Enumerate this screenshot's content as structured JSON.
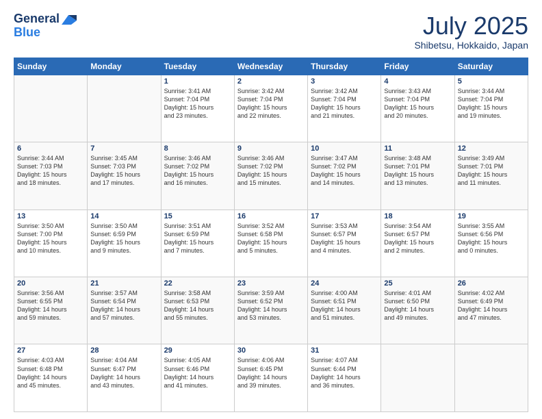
{
  "header": {
    "logo_line1": "General",
    "logo_line2": "Blue",
    "month": "July 2025",
    "location": "Shibetsu, Hokkaido, Japan"
  },
  "weekdays": [
    "Sunday",
    "Monday",
    "Tuesday",
    "Wednesday",
    "Thursday",
    "Friday",
    "Saturday"
  ],
  "weeks": [
    [
      {
        "day": "",
        "info": ""
      },
      {
        "day": "",
        "info": ""
      },
      {
        "day": "1",
        "info": "Sunrise: 3:41 AM\nSunset: 7:04 PM\nDaylight: 15 hours\nand 23 minutes."
      },
      {
        "day": "2",
        "info": "Sunrise: 3:42 AM\nSunset: 7:04 PM\nDaylight: 15 hours\nand 22 minutes."
      },
      {
        "day": "3",
        "info": "Sunrise: 3:42 AM\nSunset: 7:04 PM\nDaylight: 15 hours\nand 21 minutes."
      },
      {
        "day": "4",
        "info": "Sunrise: 3:43 AM\nSunset: 7:04 PM\nDaylight: 15 hours\nand 20 minutes."
      },
      {
        "day": "5",
        "info": "Sunrise: 3:44 AM\nSunset: 7:04 PM\nDaylight: 15 hours\nand 19 minutes."
      }
    ],
    [
      {
        "day": "6",
        "info": "Sunrise: 3:44 AM\nSunset: 7:03 PM\nDaylight: 15 hours\nand 18 minutes."
      },
      {
        "day": "7",
        "info": "Sunrise: 3:45 AM\nSunset: 7:03 PM\nDaylight: 15 hours\nand 17 minutes."
      },
      {
        "day": "8",
        "info": "Sunrise: 3:46 AM\nSunset: 7:02 PM\nDaylight: 15 hours\nand 16 minutes."
      },
      {
        "day": "9",
        "info": "Sunrise: 3:46 AM\nSunset: 7:02 PM\nDaylight: 15 hours\nand 15 minutes."
      },
      {
        "day": "10",
        "info": "Sunrise: 3:47 AM\nSunset: 7:02 PM\nDaylight: 15 hours\nand 14 minutes."
      },
      {
        "day": "11",
        "info": "Sunrise: 3:48 AM\nSunset: 7:01 PM\nDaylight: 15 hours\nand 13 minutes."
      },
      {
        "day": "12",
        "info": "Sunrise: 3:49 AM\nSunset: 7:01 PM\nDaylight: 15 hours\nand 11 minutes."
      }
    ],
    [
      {
        "day": "13",
        "info": "Sunrise: 3:50 AM\nSunset: 7:00 PM\nDaylight: 15 hours\nand 10 minutes."
      },
      {
        "day": "14",
        "info": "Sunrise: 3:50 AM\nSunset: 6:59 PM\nDaylight: 15 hours\nand 9 minutes."
      },
      {
        "day": "15",
        "info": "Sunrise: 3:51 AM\nSunset: 6:59 PM\nDaylight: 15 hours\nand 7 minutes."
      },
      {
        "day": "16",
        "info": "Sunrise: 3:52 AM\nSunset: 6:58 PM\nDaylight: 15 hours\nand 5 minutes."
      },
      {
        "day": "17",
        "info": "Sunrise: 3:53 AM\nSunset: 6:57 PM\nDaylight: 15 hours\nand 4 minutes."
      },
      {
        "day": "18",
        "info": "Sunrise: 3:54 AM\nSunset: 6:57 PM\nDaylight: 15 hours\nand 2 minutes."
      },
      {
        "day": "19",
        "info": "Sunrise: 3:55 AM\nSunset: 6:56 PM\nDaylight: 15 hours\nand 0 minutes."
      }
    ],
    [
      {
        "day": "20",
        "info": "Sunrise: 3:56 AM\nSunset: 6:55 PM\nDaylight: 14 hours\nand 59 minutes."
      },
      {
        "day": "21",
        "info": "Sunrise: 3:57 AM\nSunset: 6:54 PM\nDaylight: 14 hours\nand 57 minutes."
      },
      {
        "day": "22",
        "info": "Sunrise: 3:58 AM\nSunset: 6:53 PM\nDaylight: 14 hours\nand 55 minutes."
      },
      {
        "day": "23",
        "info": "Sunrise: 3:59 AM\nSunset: 6:52 PM\nDaylight: 14 hours\nand 53 minutes."
      },
      {
        "day": "24",
        "info": "Sunrise: 4:00 AM\nSunset: 6:51 PM\nDaylight: 14 hours\nand 51 minutes."
      },
      {
        "day": "25",
        "info": "Sunrise: 4:01 AM\nSunset: 6:50 PM\nDaylight: 14 hours\nand 49 minutes."
      },
      {
        "day": "26",
        "info": "Sunrise: 4:02 AM\nSunset: 6:49 PM\nDaylight: 14 hours\nand 47 minutes."
      }
    ],
    [
      {
        "day": "27",
        "info": "Sunrise: 4:03 AM\nSunset: 6:48 PM\nDaylight: 14 hours\nand 45 minutes."
      },
      {
        "day": "28",
        "info": "Sunrise: 4:04 AM\nSunset: 6:47 PM\nDaylight: 14 hours\nand 43 minutes."
      },
      {
        "day": "29",
        "info": "Sunrise: 4:05 AM\nSunset: 6:46 PM\nDaylight: 14 hours\nand 41 minutes."
      },
      {
        "day": "30",
        "info": "Sunrise: 4:06 AM\nSunset: 6:45 PM\nDaylight: 14 hours\nand 39 minutes."
      },
      {
        "day": "31",
        "info": "Sunrise: 4:07 AM\nSunset: 6:44 PM\nDaylight: 14 hours\nand 36 minutes."
      },
      {
        "day": "",
        "info": ""
      },
      {
        "day": "",
        "info": ""
      }
    ]
  ]
}
